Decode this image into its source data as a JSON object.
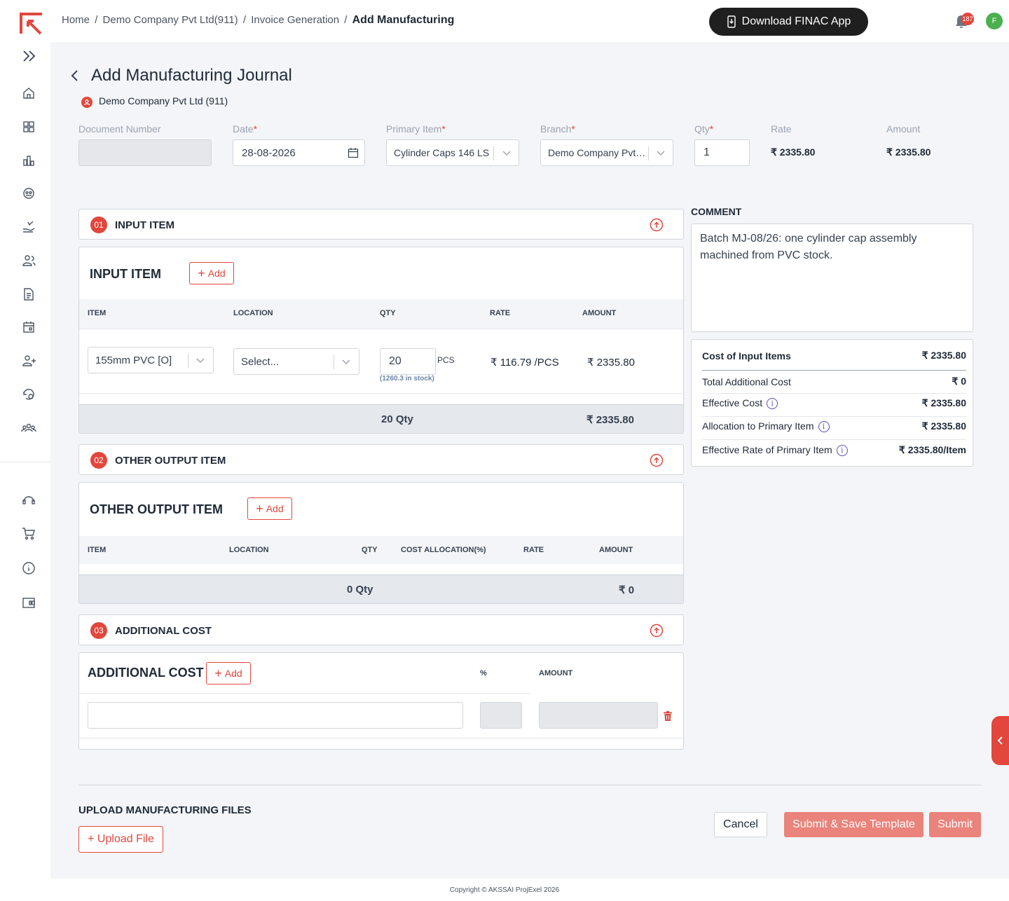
{
  "breadcrumb": {
    "items": [
      "Home",
      "Demo Company Pvt Ltd(911)",
      "Invoice Generation"
    ],
    "current": "Add Manufacturing"
  },
  "header": {
    "download_app": "Download FINAC App",
    "notification_count": "187",
    "avatar_initial": "F"
  },
  "page": {
    "title": "Add Manufacturing Journal",
    "company": "Demo Company Pvt Ltd (911)"
  },
  "form": {
    "document_number_label": "Document Number",
    "document_number_value": "",
    "date_label": "Date",
    "date_value": "28-08-2026",
    "primary_item_label": "Primary Item",
    "primary_item_value": "Cylinder Caps 146 LS",
    "branch_label": "Branch",
    "branch_value": "Demo Company Pvt…",
    "qty_label": "Qty",
    "qty_value": "1",
    "rate_label": "Rate",
    "rate_value": "₹ 2335.80",
    "amount_label": "Amount",
    "amount_value": "₹ 2335.80",
    "required_mark": "*"
  },
  "input_section": {
    "number": "01",
    "header_title": "INPUT ITEM",
    "panel_title": "INPUT ITEM",
    "add_label": "Add",
    "columns": [
      "ITEM",
      "LOCATION",
      "QTY",
      "RATE",
      "AMOUNT"
    ],
    "rows": [
      {
        "item": "155mm PVC [O]",
        "location_placeholder": "Select...",
        "qty": "20",
        "unit": "PCS",
        "stock": "(1260.3 in stock)",
        "rate": "₹ 116.79 /PCS",
        "amount": "₹ 2335.80"
      }
    ],
    "total_qty": "20 Qty",
    "total_amount": "₹ 2335.80"
  },
  "output_section": {
    "number": "02",
    "header_title": "OTHER OUTPUT ITEM",
    "panel_title": "OTHER OUTPUT ITEM",
    "add_label": "Add",
    "columns": [
      "ITEM",
      "LOCATION",
      "QTY",
      "COST ALLOCATION(%)",
      "RATE",
      "AMOUNT"
    ],
    "total_qty": "0 Qty",
    "total_amount": "₹ 0"
  },
  "additional_section": {
    "number": "03",
    "header_title": "ADDITIONAL COST",
    "panel_title": "ADDITIONAL COST",
    "add_label": "Add",
    "percent_header": "%",
    "amount_header": "AMOUNT"
  },
  "comment": {
    "label": "COMMENT",
    "text": "Batch MJ-08/26: one cylinder cap assembly machined from PVC stock."
  },
  "summary": {
    "rows": [
      {
        "label": "Cost of Input Items",
        "value": "₹ 2335.80"
      },
      {
        "label": "Total Additional Cost",
        "value": "₹ 0"
      },
      {
        "label": "Effective Cost",
        "value": "₹ 2335.80"
      },
      {
        "label": "Allocation to Primary Item",
        "value": "₹ 2335.80"
      },
      {
        "label": "Effective Rate of Primary Item",
        "value": "₹ 2335.80/Item"
      }
    ]
  },
  "upload": {
    "title": "UPLOAD MANUFACTURING FILES",
    "button": "+ Upload File"
  },
  "actions": {
    "cancel": "Cancel",
    "submit_save_template": "Submit & Save Template",
    "submit": "Submit"
  },
  "footer": {
    "copyright": "Copyright © AKSSAI ProjExel 2026"
  },
  "colors": {
    "accent": "#e2463c",
    "accent_light": "#e9837b",
    "background": "#f3f5f8"
  },
  "icons": [
    "logo-icon",
    "expand-icon",
    "home-icon",
    "grid-icon",
    "chart-icon",
    "dashboard-icon",
    "hand-coin-icon",
    "users-icon",
    "document-icon",
    "calendar-icon",
    "user-add-icon",
    "settings-clock-icon",
    "team-icon",
    "support-icon",
    "cart-icon",
    "info-icon",
    "wallet-icon",
    "bell-icon",
    "calendar-icon",
    "trash-icon",
    "arrow-up-circle-icon",
    "chevron-left-icon"
  ]
}
